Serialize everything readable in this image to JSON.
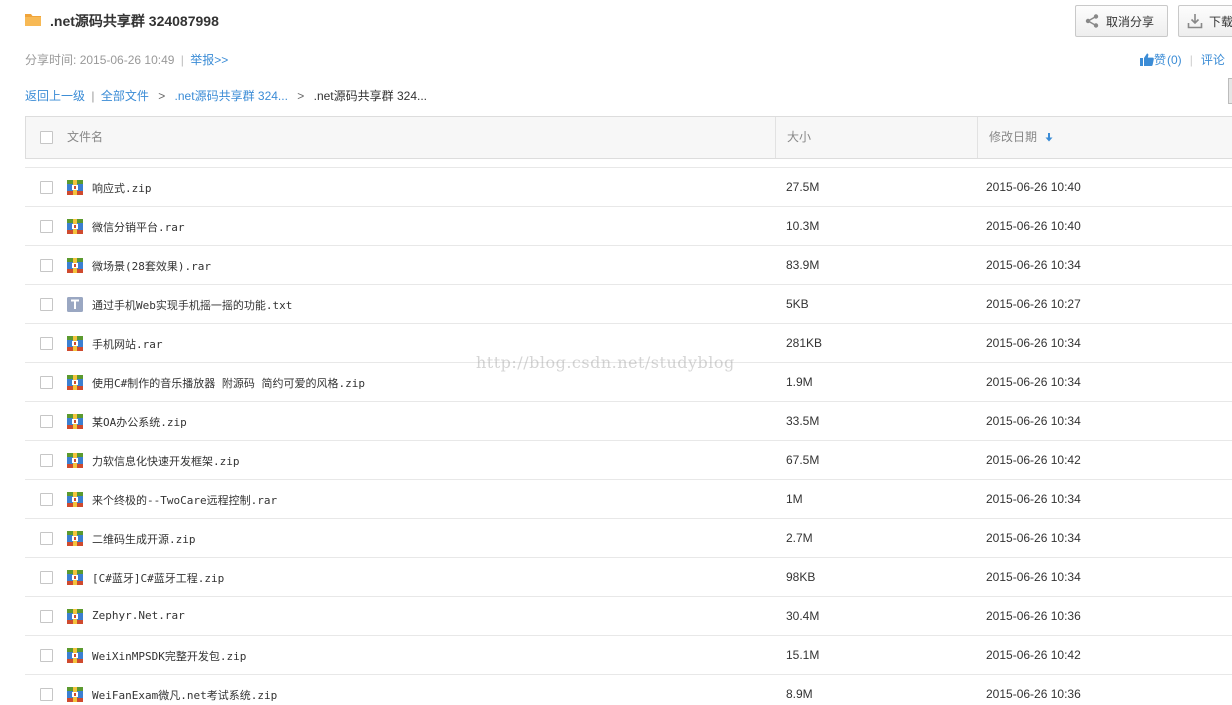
{
  "header": {
    "title": ".net源码共享群 324087998",
    "cancel_share_label": "取消分享",
    "download_label": "下载"
  },
  "meta": {
    "share_time_label": "分享时间:",
    "share_time_value": "2015-06-26 10:49",
    "separator": "|",
    "report_label": "举报>>"
  },
  "social": {
    "like_label": "赞",
    "like_count": "(0)",
    "separator": "|",
    "comment_label": "评论"
  },
  "breadcrumb": {
    "back_label": "返回上一级",
    "separator": "|",
    "all_files_label": "全部文件",
    "gt": ">",
    "level1_label": ".net源码共享群 324...",
    "current_label": ".net源码共享群 324..."
  },
  "table": {
    "columns": {
      "name": "文件名",
      "size": "大小",
      "modified": "修改日期"
    },
    "rows": [
      {
        "name": "响应式.zip",
        "size": "27.5M",
        "date": "2015-06-26 10:40",
        "type": "archive"
      },
      {
        "name": "微信分销平台.rar",
        "size": "10.3M",
        "date": "2015-06-26 10:40",
        "type": "archive"
      },
      {
        "name": "微场景(28套效果).rar",
        "size": "83.9M",
        "date": "2015-06-26 10:34",
        "type": "archive"
      },
      {
        "name": "通过手机Web实现手机摇一摇的功能.txt",
        "size": "5KB",
        "date": "2015-06-26 10:27",
        "type": "text"
      },
      {
        "name": "手机网站.rar",
        "size": "281KB",
        "date": "2015-06-26 10:34",
        "type": "archive"
      },
      {
        "name": "使用C#制作的音乐播放器 附源码 简约可爱的风格.zip",
        "size": "1.9M",
        "date": "2015-06-26 10:34",
        "type": "archive"
      },
      {
        "name": "某OA办公系统.zip",
        "size": "33.5M",
        "date": "2015-06-26 10:34",
        "type": "archive"
      },
      {
        "name": "力软信息化快速开发框架.zip",
        "size": "67.5M",
        "date": "2015-06-26 10:42",
        "type": "archive"
      },
      {
        "name": "来个终极的--TwoCare远程控制.rar",
        "size": "1M",
        "date": "2015-06-26 10:34",
        "type": "archive"
      },
      {
        "name": "二维码生成开源.zip",
        "size": "2.7M",
        "date": "2015-06-26 10:34",
        "type": "archive"
      },
      {
        "name": "[C#蓝牙]C#蓝牙工程.zip",
        "size": "98KB",
        "date": "2015-06-26 10:34",
        "type": "archive"
      },
      {
        "name": "Zephyr.Net.rar",
        "size": "30.4M",
        "date": "2015-06-26 10:36",
        "type": "archive"
      },
      {
        "name": "WeiXinMPSDK完整开发包.zip",
        "size": "15.1M",
        "date": "2015-06-26 10:42",
        "type": "archive"
      },
      {
        "name": "WeiFanExam微凡.net考试系统.zip",
        "size": "8.9M",
        "date": "2015-06-26 10:36",
        "type": "archive"
      }
    ]
  },
  "watermark": "http://blog.csdn.net/studyblog",
  "colors": {
    "link": "#3b8cd6",
    "folder": "#f0a43a",
    "header_bg": "#f7f7f7"
  },
  "icons": {
    "folder": "folder-icon",
    "archive": "archive-file-icon",
    "text": "text-file-icon",
    "share": "share-icon",
    "download": "download-icon",
    "like": "thumbs-up-icon",
    "sort": "sort-down-icon"
  }
}
